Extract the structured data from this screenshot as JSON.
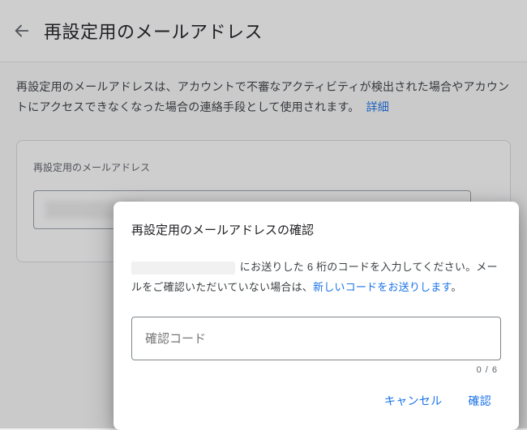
{
  "header": {
    "title": "再設定用のメールアドレス"
  },
  "description": {
    "text": "再設定用のメールアドレスは、アカウントで不審なアクティビティが検出された場合やアカウントにアクセスできなくなった場合の連絡手段として使用されます。",
    "learn_more": "詳細"
  },
  "email_card": {
    "label": "再設定用のメールアドレス"
  },
  "dialog": {
    "title": "再設定用のメールアドレスの確認",
    "body_prefix": "",
    "body_mid": " にお送りした 6 桁のコードを入力してください。メールをご確認いただいていない場合は、",
    "resend_link": "新しいコードをお送りします",
    "body_suffix": "。",
    "code_placeholder": "確認コード",
    "counter": "0 / 6",
    "cancel_label": "キャンセル",
    "confirm_label": "確認"
  }
}
